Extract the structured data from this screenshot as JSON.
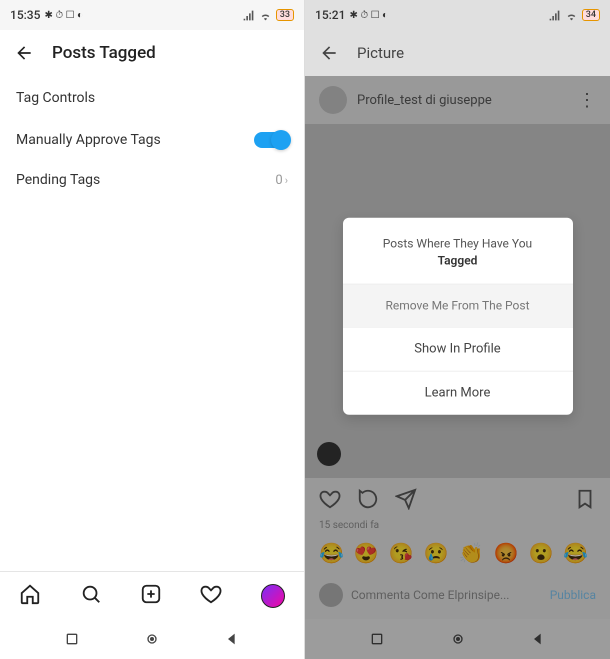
{
  "left_screen": {
    "status": {
      "time": "15:35",
      "icons": "✱ ⏱ ☐ ◐",
      "battery": "33"
    },
    "header": {
      "title": "Posts Tagged"
    },
    "section_link": "Tag Controls",
    "toggle_row": {
      "label": "Manually Approve Tags",
      "value": "on"
    },
    "pending_row": {
      "label": "Pending Tags",
      "count": "0"
    }
  },
  "right_screen": {
    "status": {
      "time": "15:21",
      "icons": "✱ ⏱ ☐ ◐",
      "battery": "34"
    },
    "header": {
      "title": "Picture"
    },
    "post": {
      "username": "Profile_test di giuseppe",
      "timestamp": "15 secondi fa",
      "comment_placeholder": "Commenta Come Elprinsipe...",
      "publish": "Pubblica"
    },
    "emojis": [
      "😂",
      "😍",
      "😘",
      "😢",
      "👏",
      "😡",
      "😮",
      "😂"
    ],
    "modal": {
      "title_line1": "Posts Where They Have You",
      "title_line2": "Tagged",
      "option1": "Remove Me From The Post",
      "option2": "Show In Profile",
      "option3": "Learn More"
    }
  }
}
